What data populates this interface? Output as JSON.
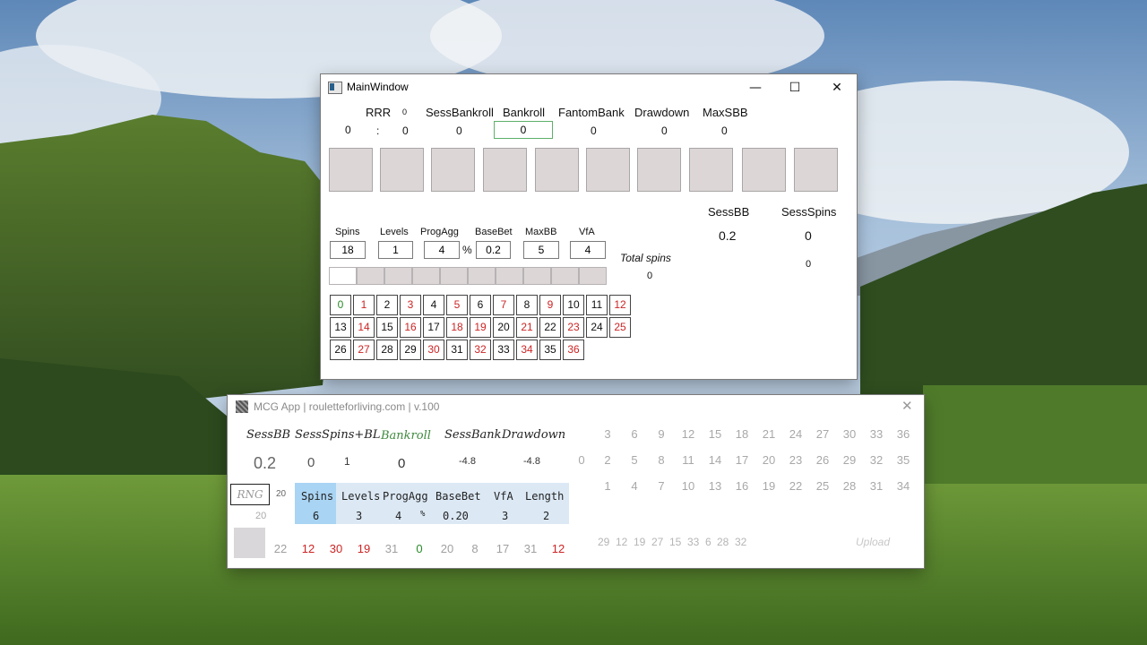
{
  "main_window": {
    "title": "MainWindow",
    "controls": {
      "minimize": "—",
      "maximize": "☐",
      "close": "✕"
    },
    "headers": {
      "rrr": "RRR",
      "rrr_small": "0",
      "sess_bankroll": "SessBankroll",
      "bankroll": "Bankroll",
      "fantom_bank": "FantomBank",
      "drawdown": "Drawdown",
      "max_sbb": "MaxSBB"
    },
    "values": {
      "rrr_left": "0",
      "colon": ":",
      "rrr_right": "0",
      "sess_bankroll": "0",
      "bankroll": "0",
      "fantom_bank": "0",
      "drawdown": "0",
      "max_sbb": "0"
    },
    "sess_bb_label": "SessBB",
    "sess_spins_label": "SessSpins",
    "sess_bb_value": "0.2",
    "sess_spins_value": "0",
    "sess_spins_sub": "0",
    "total_spins_label": "Total spins",
    "total_spins_value": "0",
    "settings": [
      {
        "label": "Spins",
        "value": "18"
      },
      {
        "label": "Levels",
        "value": "1"
      },
      {
        "label": "ProgAgg",
        "value": "4"
      },
      {
        "label": "BaseBet",
        "value": "0.2"
      },
      {
        "label": "MaxBB",
        "value": "5"
      },
      {
        "label": "VfA",
        "value": "4"
      }
    ],
    "percent_sign": "%",
    "numbers": [
      [
        "0",
        "1",
        "2",
        "3",
        "4",
        "5",
        "6",
        "7",
        "8",
        "9",
        "10",
        "11",
        "12"
      ],
      [
        "13",
        "14",
        "15",
        "16",
        "17",
        "18",
        "19",
        "20",
        "21",
        "22",
        "23",
        "24",
        "25"
      ],
      [
        "26",
        "27",
        "28",
        "29",
        "30",
        "31",
        "32",
        "33",
        "34",
        "35",
        "36"
      ]
    ]
  },
  "mcg_window": {
    "title": "MCG App | rouletteforliving.com | v.100",
    "close": "✕",
    "headers": {
      "sess_bb": "SessBB",
      "sess_spins_bl": "SessSpins+BL",
      "bankroll": "Bankroll",
      "sess_bank": "SessBank",
      "drawdown": "Drawdown"
    },
    "values": {
      "sess_bb": "0.2",
      "sess_spins": "0",
      "bl": "1",
      "bankroll": "0",
      "sess_bank": "-4.8",
      "drawdown": "-4.8"
    },
    "grid_row1": [
      "3",
      "6",
      "9",
      "12",
      "15",
      "18",
      "21",
      "24",
      "27",
      "30",
      "33",
      "36"
    ],
    "grid_row2": [
      "2",
      "5",
      "8",
      "11",
      "14",
      "17",
      "20",
      "23",
      "26",
      "29",
      "32",
      "35"
    ],
    "grid_row3": [
      "1",
      "4",
      "7",
      "10",
      "13",
      "16",
      "19",
      "22",
      "25",
      "28",
      "31",
      "34"
    ],
    "grid_zero": "0",
    "rng_label": "RNG",
    "rng_count": "20",
    "rng_sub": "20",
    "stats": {
      "headers": [
        "Spins",
        "Levels",
        "ProgAgg",
        "BaseBet",
        "VfA",
        "Length"
      ],
      "values": [
        "6",
        "3",
        "4",
        "0.20",
        "3",
        "2"
      ],
      "percent": "%"
    },
    "history": [
      {
        "n": "22",
        "color": "gray"
      },
      {
        "n": "12",
        "color": "red"
      },
      {
        "n": "30",
        "color": "red"
      },
      {
        "n": "19",
        "color": "red"
      },
      {
        "n": "31",
        "color": "gray"
      },
      {
        "n": "0",
        "color": "green"
      },
      {
        "n": "20",
        "color": "gray"
      },
      {
        "n": "8",
        "color": "gray"
      },
      {
        "n": "17",
        "color": "gray"
      },
      {
        "n": "31",
        "color": "gray"
      },
      {
        "n": "12",
        "color": "red"
      }
    ],
    "sequence": [
      "29",
      "12",
      "19",
      "27",
      "15",
      "33",
      "6",
      "28",
      "32"
    ],
    "upload_label": "Upload"
  }
}
